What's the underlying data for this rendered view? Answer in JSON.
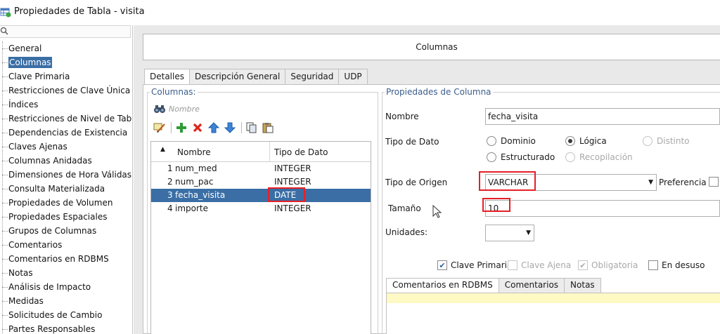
{
  "window": {
    "title": "Propiedades de Tabla - visita"
  },
  "tree": {
    "items": [
      "General",
      "Columnas",
      "Clave Primaria",
      "Restricciones de Clave Única",
      "Índices",
      "Restricciones de Nivel de Tabla",
      "Dependencias de Existencia",
      "Claves Ajenas",
      "Columnas Anidadas",
      "Dimensiones de Hora Válidas",
      "Consulta Materializada",
      "Propiedades de Volumen",
      "Propiedades Espaciales",
      "Grupos de Columnas",
      "Comentarios",
      "Comentarios en RDBMS",
      "Notas",
      "Análisis de Impacto",
      "Medidas",
      "Solicitudes de Cambio",
      "Partes Responsables"
    ],
    "selected": "Columnas"
  },
  "header": {
    "title": "Columnas"
  },
  "tabs": [
    "Detalles",
    "Descripción General",
    "Seguridad",
    "UDP"
  ],
  "columns_panel": {
    "legend": "Columnas:",
    "filter_placeholder": "Nombre",
    "table": {
      "headers": [
        "Nombre",
        "Tipo de Dato"
      ],
      "rows": [
        {
          "num": "1",
          "name": "num_med",
          "type": "INTEGER"
        },
        {
          "num": "2",
          "name": "num_pac",
          "type": "INTEGER"
        },
        {
          "num": "3",
          "name": "fecha_visita",
          "type": "DATE"
        },
        {
          "num": "4",
          "name": "importe",
          "type": "INTEGER"
        }
      ],
      "selected_row": 2
    }
  },
  "properties": {
    "legend": "Propiedades de Columna",
    "name_label": "Nombre",
    "name_value": "fecha_visita",
    "data_type_label": "Tipo de Dato",
    "radios": {
      "dominio": "Dominio",
      "logica": "Lógica",
      "distinto": "Distinto",
      "estructurado": "Estructurado",
      "recopilacion": "Recopilación"
    },
    "selected_radio": "Lógica",
    "source_type_label": "Tipo de Origen",
    "source_type_value": "VARCHAR",
    "preference_label": "Preferencia",
    "size_label": "Tamaño",
    "size_value": "10",
    "units_label": "Unidades:",
    "units_value": "",
    "checks": {
      "primary_key": "Clave Primaria",
      "foreign_key": "Clave Ajena",
      "mandatory": "Obligatoria",
      "deprecated": "En desuso"
    },
    "sub_tabs": [
      "Comentarios en RDBMS",
      "Comentarios",
      "Notas"
    ]
  },
  "colors": {
    "selection": "#3a6ea5",
    "highlight_box": "#e52026",
    "legend": "#3a5c8c"
  },
  "icons": [
    "search-icon",
    "binoculars-icon",
    "edit-icon",
    "add-icon",
    "delete-icon",
    "move-up-icon",
    "move-down-icon",
    "copy-icon",
    "paste-icon",
    "cursor-icon"
  ]
}
